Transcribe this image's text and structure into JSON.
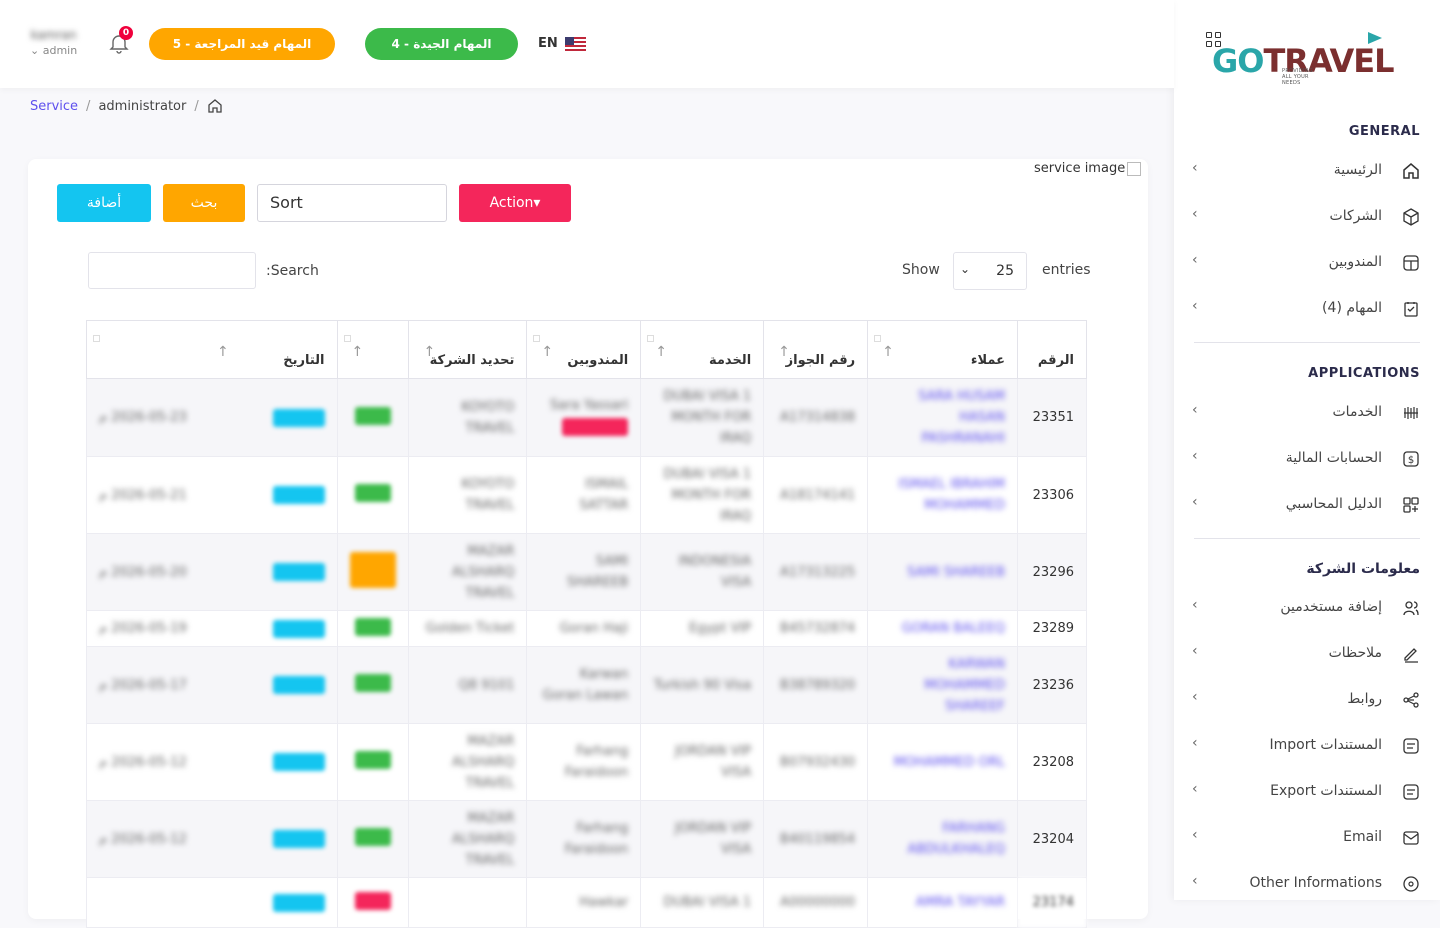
{
  "header": {
    "user_name": "kamran",
    "user_role": "admin",
    "notifications_count": "0",
    "pending_tasks_label": "5 - المهام قيد المراجعة",
    "good_tasks_label": "4 - المهام الجيدة",
    "language": "EN"
  },
  "breadcrumb": {
    "service": "Service",
    "sep1": "/",
    "admin": "administrator",
    "sep2": "/"
  },
  "sidebar": {
    "logo_go": "GO",
    "logo_travel": "TRAVEL",
    "logo_tagline": "PROVIDING ALL YOUR NEEDS",
    "section_general": "GENERAL",
    "home": "الرئيسية",
    "companies": "الشركات",
    "delegates": "المندوبين",
    "tasks": "المهام (4)",
    "section_applications": "APPLICATIONS",
    "services": "الخدمات",
    "accounts": "الحسابات المالية",
    "ledger": "الدليل المحاسبي",
    "section_company": "معلومات الشركة",
    "add_users": "إضافة مستخدمين",
    "notes": "ملاحظات",
    "links": "روابط",
    "import_docs": "Import المستندات",
    "export_docs": "Export المستندات",
    "email": "Email",
    "other_info": "Other Informations"
  },
  "toolbar": {
    "service_image_alt": "service image",
    "add_label": "أضافة",
    "search_label": "بحث",
    "sort_value": "Sort",
    "action_label": "Action▾",
    "search_field_label": ":Search",
    "show_label": "Show",
    "page_length": "25",
    "entries_label": "entries"
  },
  "table": {
    "headers": {
      "id": "الرقم",
      "client": "عملاء",
      "passport": "رقم الجواز",
      "service": "الخدمة",
      "delegates": "المندوبين",
      "company": "تحديد الشركة",
      "date": "التاريخ"
    },
    "sort_arrow": "↑",
    "rows": [
      {
        "id": "23351",
        "client": "SARA HUSAM HASAN PASHRANAHI",
        "passport": "A17314838",
        "service": "DUBAI VISA 1 MONTH FOR IRAQ",
        "delegate": "Sara Yassari",
        "company": "KOYOTO TRAVEL",
        "date": "2026-05-23 م"
      },
      {
        "id": "23306",
        "client": "ISMAEL IBRAHIM MOHAMMED",
        "passport": "A18174141",
        "service": "DUBAI VISA 1 MONTH FOR IRAQ",
        "delegate": "ISMAIL SATTAR",
        "company": "KOYOTO TRAVEL",
        "date": "2026-05-21 م"
      },
      {
        "id": "23296",
        "client": "SAMI SHAREEB",
        "passport": "A17313225",
        "service": "INDONESIA VISA",
        "delegate": "SAMI SHAREEB",
        "company": "MAZAR ALSHARQ TRAVEL",
        "date": "2026-05-20 م"
      },
      {
        "id": "23289",
        "client": "GORAN BALEEQ",
        "passport": "B45732874",
        "service": "Egypt VIP",
        "delegate": "Goran Haji",
        "company": "Golden Ticket",
        "date": "2026-05-19 م"
      },
      {
        "id": "23236",
        "client": "KARWAN MOHAMMED SHAREEF",
        "passport": "B38789320",
        "service": "Turkish 90 Visa",
        "delegate": "Karwan Goran Lawan",
        "company": "Q8 9101",
        "date": "2026-05-17 م"
      },
      {
        "id": "23208",
        "client": "MOHAMMED ORL",
        "passport": "B07932430",
        "service": "JORDAN VIP VISA",
        "delegate": "Farhang Faraidoon",
        "company": "MAZAR ALSHARQ TRAVEL",
        "date": "2026-05-12 م"
      },
      {
        "id": "23204",
        "client": "FARHANG ABDULKHALEQ",
        "passport": "B40119854",
        "service": "JORDAN VIP VISA",
        "delegate": "Farhang Faraidoon",
        "company": "MAZAR ALSHARQ TRAVEL",
        "date": "2026-05-12 م"
      },
      {
        "id": "23174",
        "client": "AMRA TAYYAR",
        "passport": "A00000000",
        "service": "DUBAI VISA 1",
        "delegate": "Hawkar",
        "company": "",
        "date": ""
      }
    ]
  }
}
